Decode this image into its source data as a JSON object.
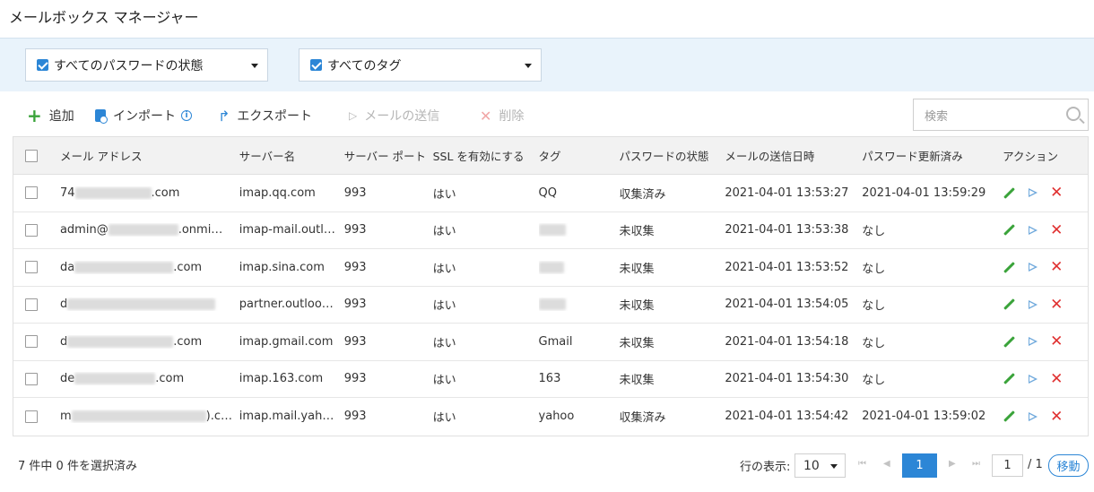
{
  "title": "メールボックス マネージャー",
  "filters": {
    "password_state": "すべてのパスワードの状態",
    "tags": "すべてのタグ"
  },
  "toolbar": {
    "add": "追加",
    "import": "インポート",
    "info": "i",
    "export": "エクスポート",
    "send_mail": "メールの送信",
    "delete": "削除"
  },
  "search": {
    "placeholder": "検索"
  },
  "table": {
    "headers": [
      "メール アドレス",
      "サーバー名",
      "サーバー ポート",
      "SSL を有効にする",
      "タグ",
      "パスワードの状態",
      "メールの送信日時",
      "パスワード更新済み",
      "アクション"
    ],
    "rows": [
      {
        "email_prefix": "74",
        "email_suffix": ".com",
        "server": "imap.qq.com",
        "port": "993",
        "ssl": "はい",
        "tag": "QQ",
        "pwd_state": "収集済み",
        "sent": "2021-04-01 13:53:27",
        "updated": "2021-04-01 13:59:29"
      },
      {
        "email_prefix": "admin@",
        "email_suffix": ".onmi…",
        "server": "imap-mail.outl…",
        "port": "993",
        "ssl": "はい",
        "tag": "",
        "pwd_state": "未収集",
        "sent": "2021-04-01 13:53:38",
        "updated": "なし"
      },
      {
        "email_prefix": "da",
        "email_suffix": ".com",
        "server": "imap.sina.com",
        "port": "993",
        "ssl": "はい",
        "tag": "",
        "pwd_state": "未収集",
        "sent": "2021-04-01 13:53:52",
        "updated": "なし"
      },
      {
        "email_prefix": "d",
        "email_suffix": "",
        "server": "partner.outlook…",
        "port": "993",
        "ssl": "はい",
        "tag": "",
        "pwd_state": "未収集",
        "sent": "2021-04-01 13:54:05",
        "updated": "なし"
      },
      {
        "email_prefix": "d",
        "email_suffix": ".com",
        "server": "imap.gmail.com",
        "port": "993",
        "ssl": "はい",
        "tag": "Gmail",
        "pwd_state": "未収集",
        "sent": "2021-04-01 13:54:18",
        "updated": "なし"
      },
      {
        "email_prefix": "de",
        "email_suffix": ".com",
        "server": "imap.163.com",
        "port": "993",
        "ssl": "はい",
        "tag": "163",
        "pwd_state": "未収集",
        "sent": "2021-04-01 13:54:30",
        "updated": "なし"
      },
      {
        "email_prefix": "m",
        "email_suffix": ").c…",
        "server": "imap.mail.yaho…",
        "port": "993",
        "ssl": "はい",
        "tag": "yahoo",
        "pwd_state": "収集済み",
        "sent": "2021-04-01 13:54:42",
        "updated": "2021-04-01 13:59:02"
      }
    ]
  },
  "footer": {
    "selection": "7 件中 0 件を選択済み",
    "rows_label": "行の表示:",
    "rows_value": "10",
    "current_page": "1",
    "page_input": "1",
    "total": "/ 1",
    "go": "移動"
  },
  "colors": {
    "accent": "#2c86d6",
    "add": "#3aa33a",
    "delete": "#e03131",
    "filter_bg": "#e9f3fb"
  }
}
